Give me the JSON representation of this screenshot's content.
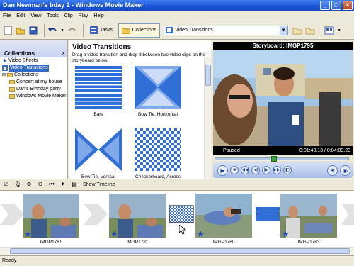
{
  "window": {
    "title": "Dan Newman's bday 2 - Windows Movie Maker"
  },
  "menu": [
    "File",
    "Edit",
    "View",
    "Tools",
    "Clip",
    "Play",
    "Help"
  ],
  "toolbar": {
    "tasks_label": "Tasks",
    "collections_label": "Collections",
    "location_value": "Video Transitions"
  },
  "collections": {
    "header": "Collections",
    "close": "×",
    "items": [
      "Video Effects",
      "Video Transitions",
      "Collections",
      "Concert at my house",
      "Dan's Birthday party",
      "Windows Movie Maker"
    ]
  },
  "transitions": {
    "title": "Video Transitions",
    "description": "Drag a video transition and drop it between two video clips on the storyboard below.",
    "items": [
      "Bars",
      "Bow Tie, Horizontal",
      "Bow Tie, Vertical",
      "Checkerboard, Across"
    ]
  },
  "monitor": {
    "title": "Storyboard: IMGP1795",
    "state": "Paused",
    "time": "0:01:49.13 / 0:04:09.20",
    "seek_fraction": 0.44
  },
  "storyboard": {
    "show_timeline": "Show Timeline",
    "clips": [
      "IMGP1781",
      "IMGP1781",
      "IMGP1780",
      "IMGP1783"
    ]
  },
  "status": {
    "text": "Ready"
  },
  "colors": {
    "titlebar": "#1c55d6",
    "selection": "#316ac5",
    "transition_blue": "#2f6fd6"
  }
}
